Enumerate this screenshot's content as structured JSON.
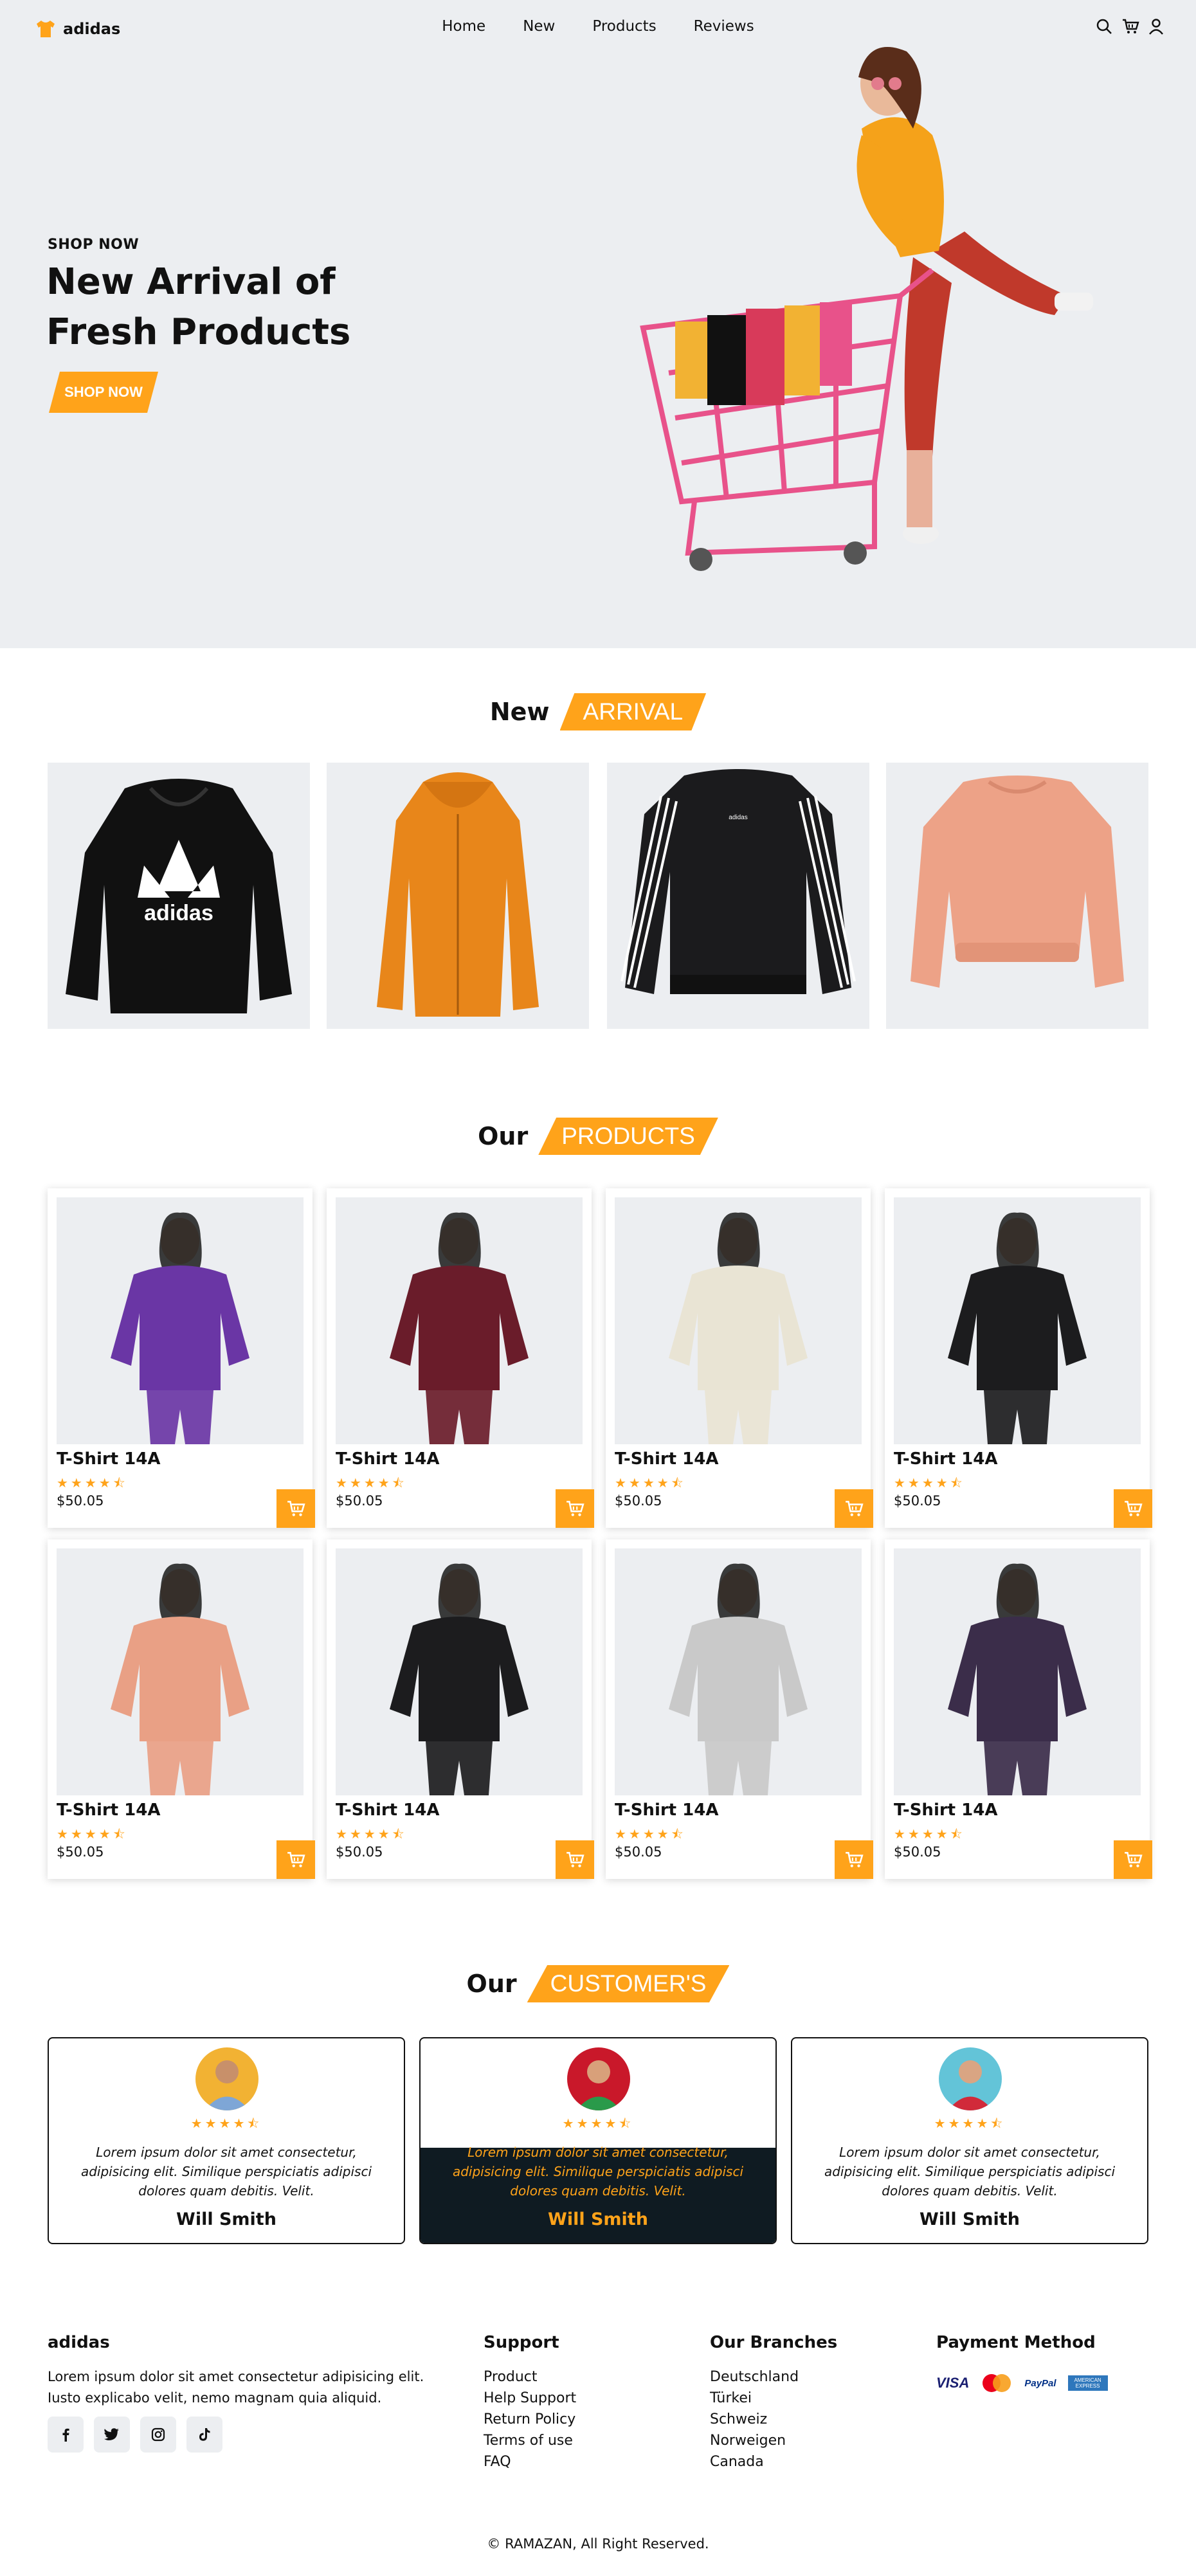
{
  "header": {
    "logo": "adidas",
    "nav": [
      "Home",
      "New",
      "Products",
      "Reviews"
    ]
  },
  "hero": {
    "kicker": "SHOP NOW",
    "title_line1": "New Arrival of",
    "title_line2": "Fresh Products",
    "button": "SHOP NOW"
  },
  "arrival": {
    "word1": "New",
    "word2": "ARRIVAL",
    "items": [
      "hoodie-black-trefoil",
      "jacket-orange",
      "sweatshirt-black-stripes",
      "sweatshirt-pink"
    ]
  },
  "products": {
    "word1": "Our",
    "word2": "PRODUCTS",
    "stars": "★★★★⯪",
    "items": [
      {
        "name": "T-Shirt 14A",
        "price": "$50.05",
        "color": "#6a36a5"
      },
      {
        "name": "T-Shirt 14A",
        "price": "$50.05",
        "color": "#6a1c2a"
      },
      {
        "name": "T-Shirt 14A",
        "price": "$50.05",
        "color": "#e9e4d4"
      },
      {
        "name": "T-Shirt 14A",
        "price": "$50.05",
        "color": "#1c1c1e"
      },
      {
        "name": "T-Shirt 14A",
        "price": "$50.05",
        "color": "#e9a085"
      },
      {
        "name": "T-Shirt 14A",
        "price": "$50.05",
        "color": "#1c1c1e"
      },
      {
        "name": "T-Shirt 14A",
        "price": "$50.05",
        "color": "#c9c9c9"
      },
      {
        "name": "T-Shirt 14A",
        "price": "$50.05",
        "color": "#3b2d4a"
      }
    ]
  },
  "customers": {
    "word1": "Our",
    "word2": "CUSTOMER'S",
    "stars": "★★★★⯪",
    "items": [
      {
        "text": "Lorem ipsum dolor sit amet consectetur, adipisicing elit. Similique perspiciatis adipisci dolores quam debitis. Velit.",
        "name": "Will Smith",
        "avatar_bg": "#f2b233"
      },
      {
        "text": "Lorem ipsum dolor sit amet consectetur, adipisicing elit. Similique perspiciatis adipisci dolores quam debitis. Velit.",
        "name": "Will Smith",
        "avatar_bg": "#c9182a"
      },
      {
        "text": "Lorem ipsum dolor sit amet consectetur, adipisicing elit. Similique perspiciatis adipisci dolores quam debitis. Velit.",
        "name": "Will Smith",
        "avatar_bg": "#63c4d8"
      }
    ]
  },
  "footer": {
    "brand": "adidas",
    "desc": "Lorem ipsum dolor sit amet consectetur adipisicing elit. Iusto explicabo velit, nemo magnam quia aliquid.",
    "social": [
      "facebook-icon",
      "twitter-icon",
      "instagram-icon",
      "tiktok-icon"
    ],
    "support_title": "Support",
    "support": [
      "Product",
      "Help Support",
      "Return Policy",
      "Terms of use",
      "FAQ"
    ],
    "branches_title": "Our Branches",
    "branches": [
      "Deutschland",
      "Türkei",
      "Schweiz",
      "Norweigen",
      "Canada"
    ],
    "payment_title": "Payment Method",
    "payment": [
      "VISA",
      "mastercard-icon",
      "PayPal",
      "AMERICAN EXPRESS"
    ],
    "copyright": "© RAMAZAN, All Right Reserved."
  },
  "colors": {
    "accent": "#ffa31a",
    "hero_bg": "#eceef1",
    "dark_card": "#0f1b22"
  }
}
